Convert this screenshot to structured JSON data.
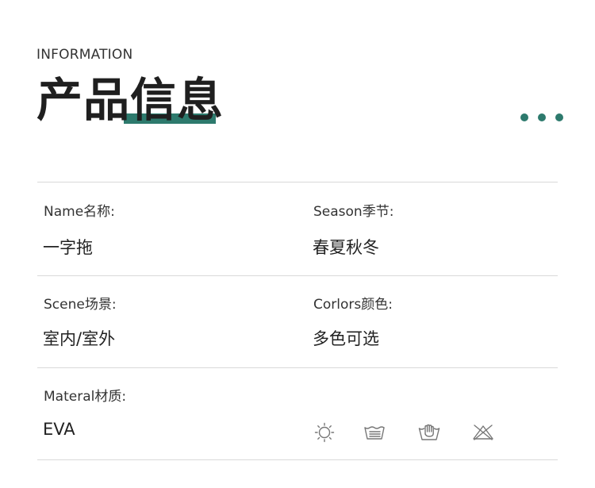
{
  "header": {
    "eyebrow": "INFORMATION",
    "title": "产品信息"
  },
  "info": {
    "name_label": "Name名称:",
    "name_value": "一字拖",
    "season_label": "Season季节:",
    "season_value": "春夏秋冬",
    "scene_label": "Scene场景:",
    "scene_value": "室内/室外",
    "colors_label": "Corlors颜色:",
    "colors_value": "多色可选",
    "material_label": "Materal材质:",
    "material_value": "EVA"
  },
  "care_icons": [
    "sun-dry-icon",
    "machine-wash-icon",
    "hand-wash-icon",
    "do-not-bleach-icon"
  ],
  "colors": {
    "accent": "#2d7a6d",
    "rule": "#d9d9d9",
    "text": "#222222",
    "icon": "#777777"
  }
}
